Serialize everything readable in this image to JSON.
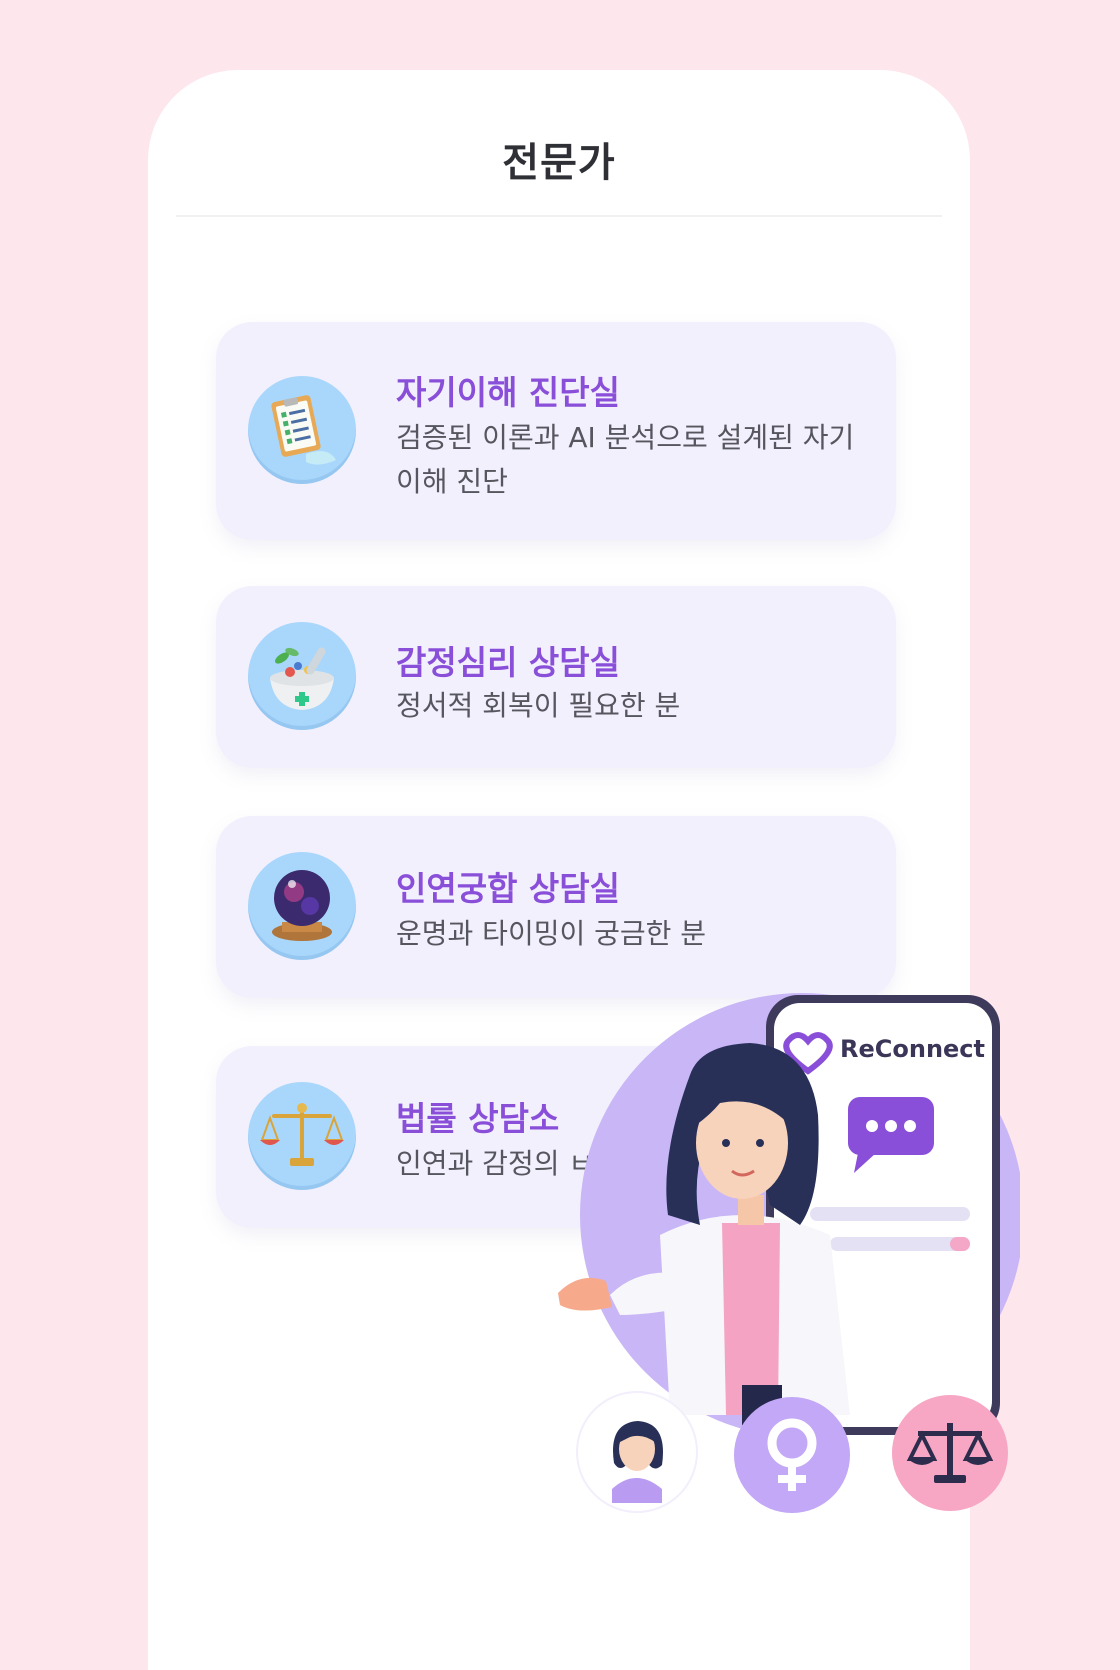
{
  "header": {
    "title": "전문가"
  },
  "cards": [
    {
      "title": "자기이해 진단실",
      "desc": "검증된 이론과 AI 분석으로 설계된 자기 이해 진단",
      "icon": "clipboard-checklist-icon"
    },
    {
      "title": "감정심리 상담실",
      "desc": "정서적 회복이 필요한 분",
      "icon": "herb-mortar-bowl-icon"
    },
    {
      "title": "인연궁합 상담실",
      "desc": "운명과 타이밍이 궁금한 분",
      "icon": "crystal-ball-icon"
    },
    {
      "title": "법률 상담소",
      "desc": "인연과 감정의 ㅂ",
      "icon": "balance-scale-icon"
    }
  ],
  "illustration": {
    "brand": "ReConnect"
  },
  "colors": {
    "background": "#fde6ec",
    "accent": "#8a4fd8",
    "card": "#f3f0fe",
    "icon_bg": "#a9d7fb"
  }
}
